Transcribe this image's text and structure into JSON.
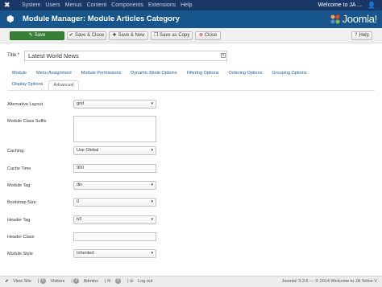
{
  "topbar": {
    "menu": [
      "System",
      "Users",
      "Menus",
      "Content",
      "Components",
      "Extensions",
      "Help"
    ],
    "welcome": "Welcome to JA ...",
    "brand_color": "#1a3867"
  },
  "header": {
    "title": "Module Manager: Module Articles Category",
    "brand": "Joomla!",
    "bg_color": "#17568c"
  },
  "toolbar": {
    "save": "Save",
    "save_close": "Save & Close",
    "save_new": "Save & New",
    "save_copy": "Save as Copy",
    "close": "Close",
    "help": "Help"
  },
  "form": {
    "title_label": "Title *",
    "title_value": "Latest World News"
  },
  "tabs": {
    "row1": [
      "Module",
      "Menu Assignment",
      "Module Permissions",
      "Dynamic Mode Options",
      "Filtering Options",
      "Ordering Options",
      "Grouping Options"
    ],
    "row2": [
      "Display Options",
      "Advanced"
    ],
    "active": "Advanced"
  },
  "fields": {
    "alt_layout": {
      "label": "Alternative Layout",
      "value": "grid"
    },
    "class_suffix": {
      "label": "Module Class Suffix",
      "value": ""
    },
    "caching": {
      "label": "Caching",
      "value": "Use Global"
    },
    "cache_time": {
      "label": "Cache Time",
      "value": "900"
    },
    "module_tag": {
      "label": "Module Tag",
      "value": "div"
    },
    "bootstrap_size": {
      "label": "Bootstrap Size",
      "value": "0"
    },
    "header_tag": {
      "label": "Header Tag",
      "value": "h3"
    },
    "header_class": {
      "label": "Header Class",
      "value": ""
    },
    "module_style": {
      "label": "Module Style",
      "value": "Inherited"
    }
  },
  "footer": {
    "view_site": "View Site",
    "visitors_count": "0",
    "visitors": "Visitors",
    "admins_count": "2",
    "admins": "Admins",
    "messages_count": "0",
    "logout": "Log out",
    "copyright": "Joomla! 3.3.6 — © 2014 Welcome to JA Teline V"
  }
}
